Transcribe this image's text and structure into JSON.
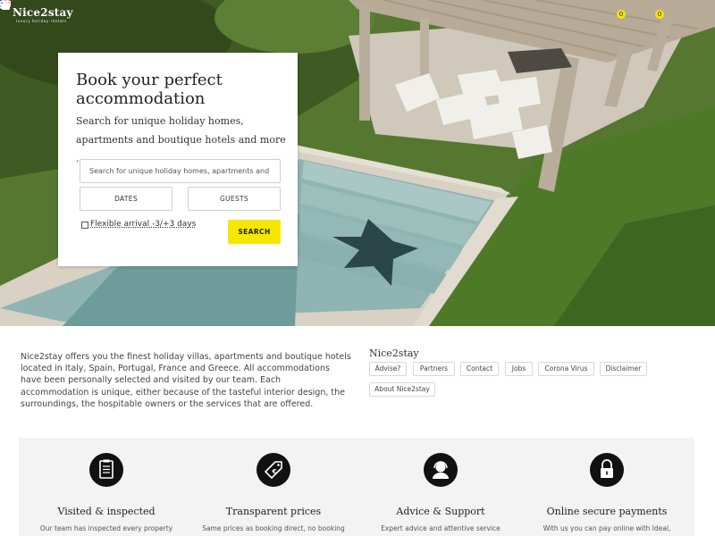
{
  "header": {
    "logo": {
      "name": "Nice2stay",
      "tagline": "luxury holiday rentals"
    },
    "language_icon": "us-flag-icon",
    "favorites_count": "0",
    "cart_count": "0"
  },
  "booking": {
    "title": "Book your perfect accommodation",
    "subtitle": "Search for unique holiday homes, apartments and boutique hotels and more ...",
    "search_placeholder": "Search for unique holiday homes, apartments and boutique hotels",
    "dates_label": "DATES",
    "guests_label": "GUESTS",
    "flexible_label": "Flexible arrival -3/+3 days",
    "search_label": "SEARCH"
  },
  "intro": {
    "text": "Nice2stay offers you the finest holiday villas, apartments and boutique hotels located in Italy, Spain, Portugal, France and Greece. All accommodations have been personally selected and visited by our team. Each accommodation is unique, either because of the tasteful interior design, the surroundings, the hospitable owners or the services that are offered."
  },
  "links": {
    "title": "Nice2stay",
    "items": [
      "Advise?",
      "Partners",
      "Contact",
      "Jobs",
      "Corona Virus",
      "Disclaimer",
      "About Nice2stay"
    ]
  },
  "features": [
    {
      "icon": "clipboard-icon",
      "title": "Visited & inspected",
      "desc": "Our team has inspected every property"
    },
    {
      "icon": "price-tag-icon",
      "title": "Transparent prices",
      "desc": "Same prices as booking direct, no booking"
    },
    {
      "icon": "support-agent-icon",
      "title": "Advice & Support",
      "desc": "Expert advice and attentive service"
    },
    {
      "icon": "padlock-icon",
      "title": "Online secure payments",
      "desc": "With us you can pay online with Ideal,"
    }
  ],
  "colors": {
    "accent": "#f6e600",
    "feature_bg": "#f3f3f3"
  }
}
